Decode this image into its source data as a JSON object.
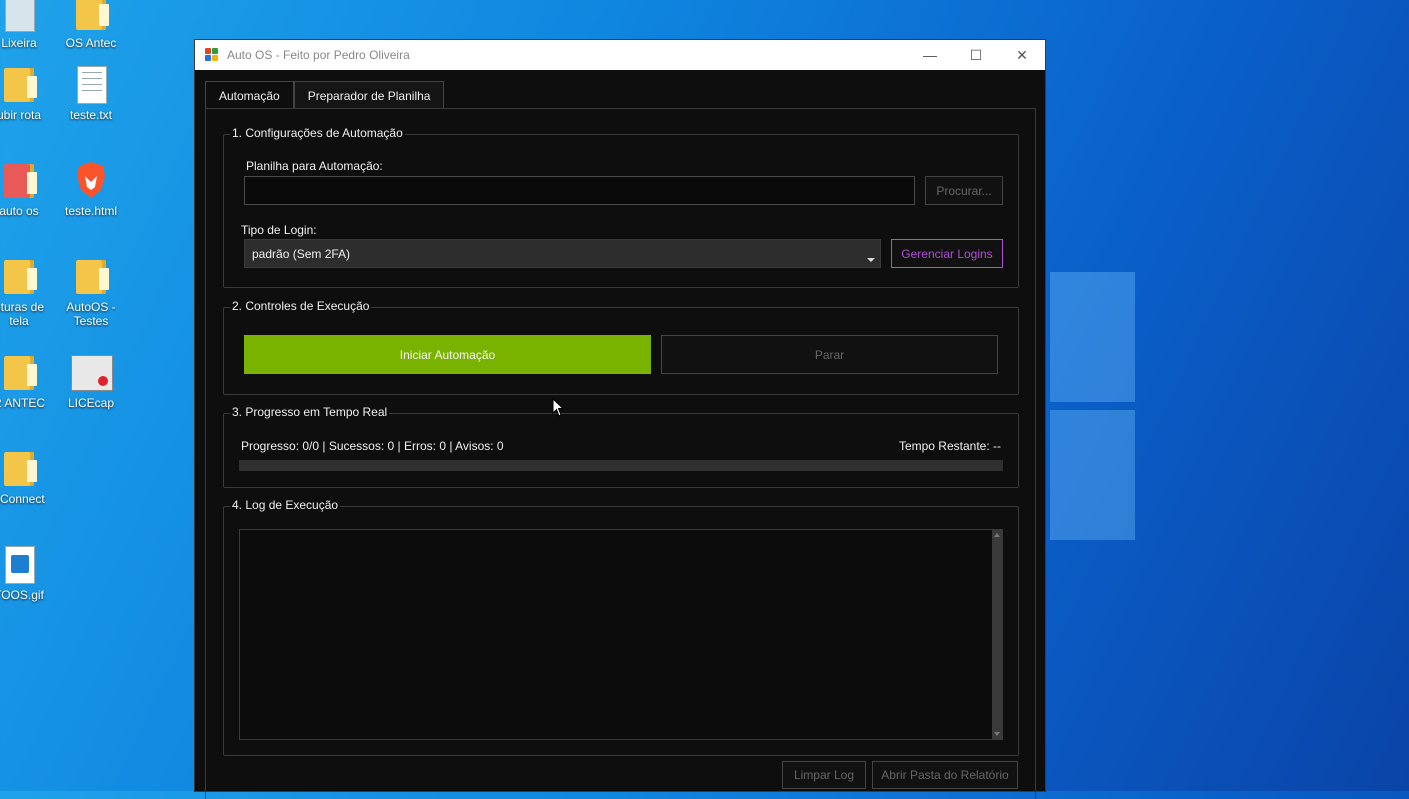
{
  "desktop": {
    "icons": [
      {
        "label": "Lixeira"
      },
      {
        "label": "OS Antec"
      },
      {
        "label": "ubir rota"
      },
      {
        "label": "teste.txt"
      },
      {
        "label": "auto os"
      },
      {
        "label": "teste.html"
      },
      {
        "label": "pturas de tela"
      },
      {
        "label": "AutoOS - Testes"
      },
      {
        "label": "R ANTEC"
      },
      {
        "label": "LICEcap"
      },
      {
        "label": "oConnect"
      },
      {
        "label": "TOOS.gif"
      }
    ]
  },
  "window": {
    "title": "Auto OS - Feito por Pedro Oliveira",
    "controls": {
      "minimize": "—",
      "maximize": "☐",
      "close": "✕"
    }
  },
  "tabs": [
    {
      "label": "Automação",
      "active": true
    },
    {
      "label": "Preparador de Planilha",
      "active": false
    }
  ],
  "config": {
    "title": "1. Configurações de Automação",
    "sheet_label": "Planilha para Automação:",
    "sheet_value": "",
    "browse_label": "Procurar...",
    "login_type_label": "Tipo de Login:",
    "login_type_value": "padrão (Sem 2FA)",
    "manage_logins_label": "Gerenciar Logins",
    "manage_logins_color": "#b04fd6"
  },
  "controls": {
    "title": "2. Controles de Execução",
    "start_label": "Iniciar Automação",
    "start_color": "#79b300",
    "stop_label": "Parar"
  },
  "progress": {
    "title": "3. Progresso em Tempo Real",
    "status_text": "Progresso: 0/0 | Sucessos: 0 | Erros: 0 | Avisos: 0",
    "time_remaining": "Tempo Restante: --",
    "fraction": 0
  },
  "log": {
    "title": "4. Log de Execução",
    "content": "",
    "clear_label": "Limpar Log",
    "open_report_label": "Abrir Pasta do Relatório"
  }
}
